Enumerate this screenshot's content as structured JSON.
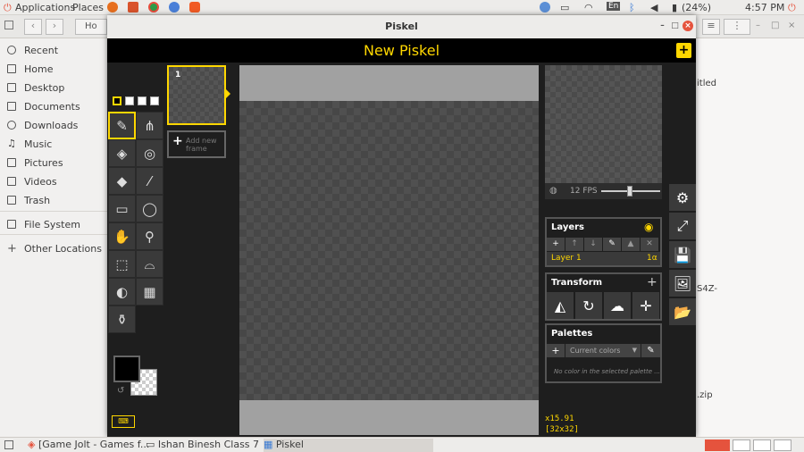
{
  "topbar": {
    "applications": "Applications",
    "places": "Places",
    "lang": "En",
    "battery": "(24%)",
    "time": "4:57 PM"
  },
  "taskbar": {
    "items": [
      {
        "label": "[Game Jolt - Games f..."
      },
      {
        "label": "Ishan Binesh Class 7"
      },
      {
        "label": "Piskel"
      }
    ]
  },
  "filemanager": {
    "location": "Ho",
    "sidebar": [
      "Recent",
      "Home",
      "Desktop",
      "Documents",
      "Downloads",
      "Music",
      "Pictures",
      "Videos",
      "Trash",
      "File System",
      "Other Locations"
    ],
    "bg_texts": [
      "itled",
      "S4Z-",
      ".zip"
    ]
  },
  "window": {
    "title": "Piskel"
  },
  "piskel": {
    "title": "New Piskel",
    "add_button": "+",
    "frame": {
      "number": "1"
    },
    "add_frame": "Add new frame",
    "fps": "12 FPS",
    "layers": {
      "title": "Layers",
      "layer_name": "Layer 1",
      "opacity": "1α"
    },
    "transform": {
      "title": "Transform"
    },
    "palettes": {
      "title": "Palettes",
      "select": "Current colors",
      "empty": "No color in the selected palette ..."
    },
    "cursor": {
      "coords": "x15.91",
      "size": "[32x32]"
    },
    "colors": {
      "accent": "#ffd700",
      "primary_color": "#000000",
      "background": "#1e1e1e"
    }
  }
}
